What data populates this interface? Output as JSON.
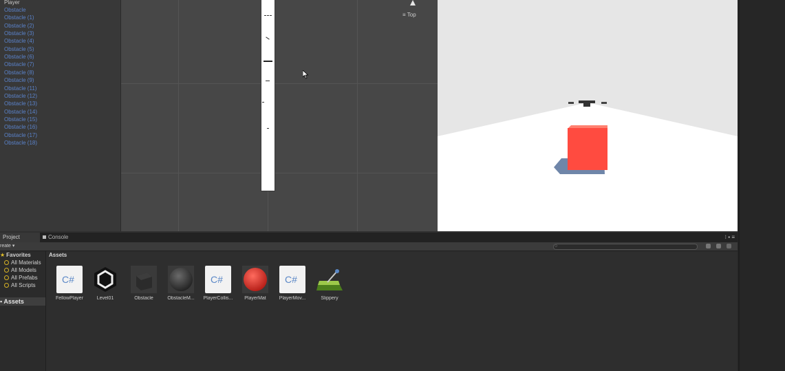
{
  "hierarchy": {
    "items": [
      "Player",
      "Obstacle",
      "Obstacle (1)",
      "Obstacle (2)",
      "Obstacle (3)",
      "Obstacle (4)",
      "Obstacle (5)",
      "Obstacle (6)",
      "Obstacle (7)",
      "Obstacle (8)",
      "Obstacle (9)",
      "Obstacle (11)",
      "Obstacle (12)",
      "Obstacle (13)",
      "Obstacle (14)",
      "Obstacle (15)",
      "Obstacle (16)",
      "Obstacle (17)",
      "Obstacle (18)"
    ]
  },
  "scene": {
    "view_label": "Top"
  },
  "tabs": {
    "project": "Project",
    "console": "Console"
  },
  "toolbar": {
    "create_label": "reate"
  },
  "favorites": {
    "title": "Favorites",
    "items": [
      "All Materials",
      "All Models",
      "All Prefabs",
      "All Scripts"
    ]
  },
  "folder": {
    "assets": "Assets"
  },
  "assets_header": "Assets",
  "assets": [
    {
      "label": "FellowPlayer",
      "icon": "csharp-script-icon"
    },
    {
      "label": "Level01",
      "icon": "unity-scene-icon"
    },
    {
      "label": "Obstacle",
      "icon": "prefab-cube-icon"
    },
    {
      "label": "ObstacleM...",
      "icon": "material-sphere-icon"
    },
    {
      "label": "PlayerCollis...",
      "icon": "csharp-script-icon"
    },
    {
      "label": "PlayerMat",
      "icon": "material-sphere-icon"
    },
    {
      "label": "PlayerMov...",
      "icon": "csharp-script-icon"
    },
    {
      "label": "Slippery",
      "icon": "physic-material-icon"
    }
  ],
  "colors": {
    "obstacle_text": "#5a82c9",
    "player_cube": "#ff4b40",
    "player_mat": "#e03030",
    "game_sky": "#e6e6e6"
  }
}
